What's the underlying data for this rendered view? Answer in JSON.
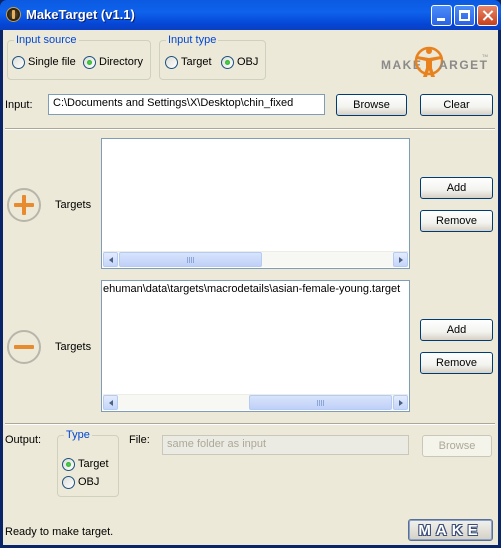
{
  "window": {
    "title": "MakeTarget (v1.1)"
  },
  "input_source": {
    "legend": "Input source",
    "options": [
      {
        "label": "Single file",
        "selected": false
      },
      {
        "label": "Directory",
        "selected": true
      }
    ]
  },
  "input_type": {
    "legend": "Input type",
    "options": [
      {
        "label": "Target",
        "selected": false
      },
      {
        "label": "OBJ",
        "selected": true
      }
    ]
  },
  "logo": {
    "text_left": "MAKE",
    "text_right": "ARGET",
    "accent_color": "#e8821e",
    "text_color": "#8a8a8a",
    "tm": "TM"
  },
  "input": {
    "label": "Input:",
    "value": "C:\\Documents and Settings\\X\\Desktop\\chin_fixed",
    "browse_label": "Browse",
    "clear_label": "Clear"
  },
  "add_targets": {
    "icon": "plus-circle-icon",
    "label": "Targets",
    "items": [],
    "add_label": "Add",
    "remove_label": "Remove"
  },
  "remove_targets": {
    "icon": "minus-circle-icon",
    "label": "Targets",
    "items": [
      "ehuman\\data\\targets\\macrodetails\\asian-female-young.target"
    ],
    "add_label": "Add",
    "remove_label": "Remove"
  },
  "output": {
    "label": "Output:",
    "type_legend": "Type",
    "options": [
      {
        "label": "Target",
        "selected": true
      },
      {
        "label": "OBJ",
        "selected": false
      }
    ],
    "file_label": "File:",
    "file_placeholder": "same folder as input",
    "browse_label": "Browse"
  },
  "status": {
    "text": "Ready to make target.",
    "make_label": "MAKE"
  },
  "colors": {
    "title_bar": "#0b5ae0",
    "group_legend": "#0046d5",
    "icon_accent": "#e88a2e",
    "dialog_background": "#ece9d8"
  }
}
